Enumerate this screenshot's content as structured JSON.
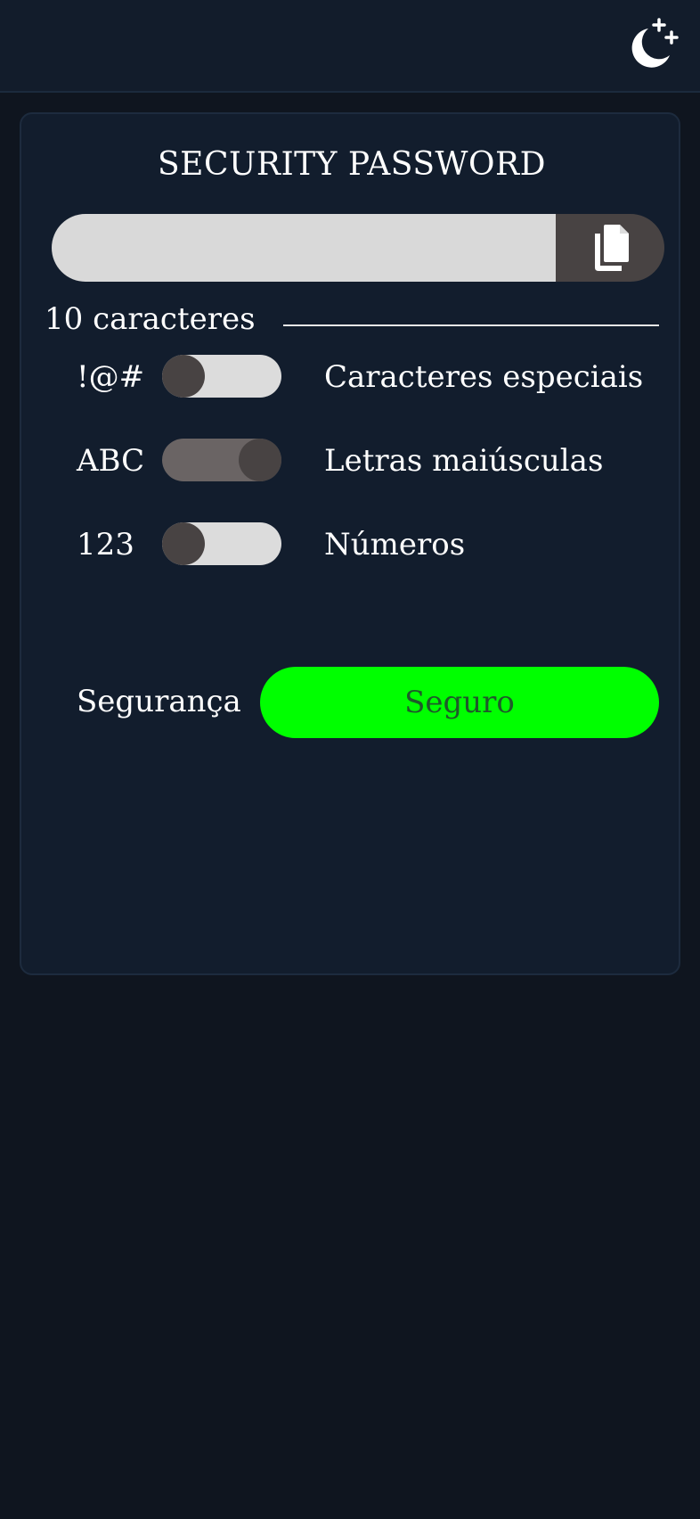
{
  "header": {
    "theme_toggle_icon": "moon-stars-icon"
  },
  "generator": {
    "title": "SECURITY PASSWORD",
    "password_value": "",
    "copy_icon": "copy-icon",
    "length_label": "10 caracteres"
  },
  "options": [
    {
      "symbol": "!@#",
      "label": "Caracteres especiais",
      "enabled": false
    },
    {
      "symbol": "ABC",
      "label": "Letras maiúsculas",
      "enabled": true
    },
    {
      "symbol": "123",
      "label": "Números",
      "enabled": false
    }
  ],
  "security": {
    "label": "Segurança",
    "status": "Seguro",
    "status_color": "#00ff00"
  },
  "colors": {
    "background": "#0f151f",
    "card": "#121d2d",
    "toggle_knob": "#484343",
    "toggle_track_off": "#dcdcdc",
    "toggle_track_on": "#6a6464"
  }
}
